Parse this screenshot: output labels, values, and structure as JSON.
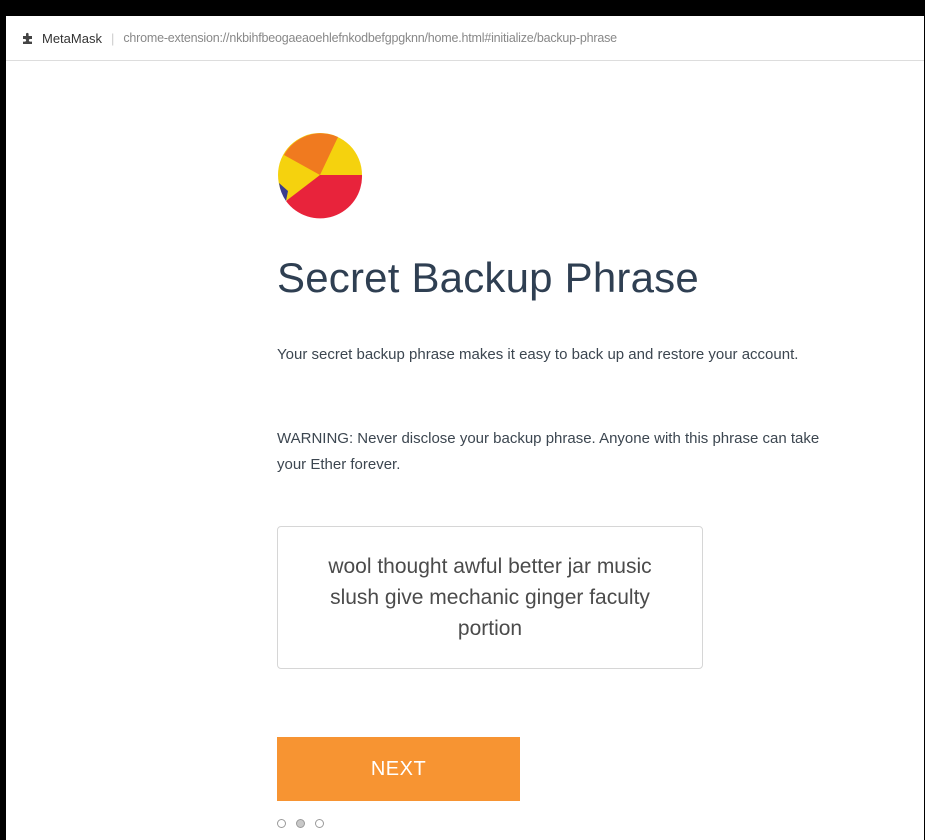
{
  "browser": {
    "extension_name": "MetaMask",
    "url": "chrome-extension://nkbihfbeogaeaoehlefnkodbefgpgknn/home.html#initialize/backup-phrase",
    "extension_icon": "puzzle-icon"
  },
  "page": {
    "logo": "metamask-logo",
    "title": "Secret Backup Phrase",
    "description": "Your secret backup phrase makes it easy to back up and restore your account.",
    "warning": "WARNING: Never disclose your backup phrase. Anyone with this phrase can take your Ether forever.",
    "phrase": "wool thought awful better jar music slush give mechanic ginger faculty portion",
    "next_label": "NEXT",
    "steps_total": 3,
    "current_step": 2
  },
  "colors": {
    "accent": "#f79432",
    "title": "#2f3f52"
  }
}
